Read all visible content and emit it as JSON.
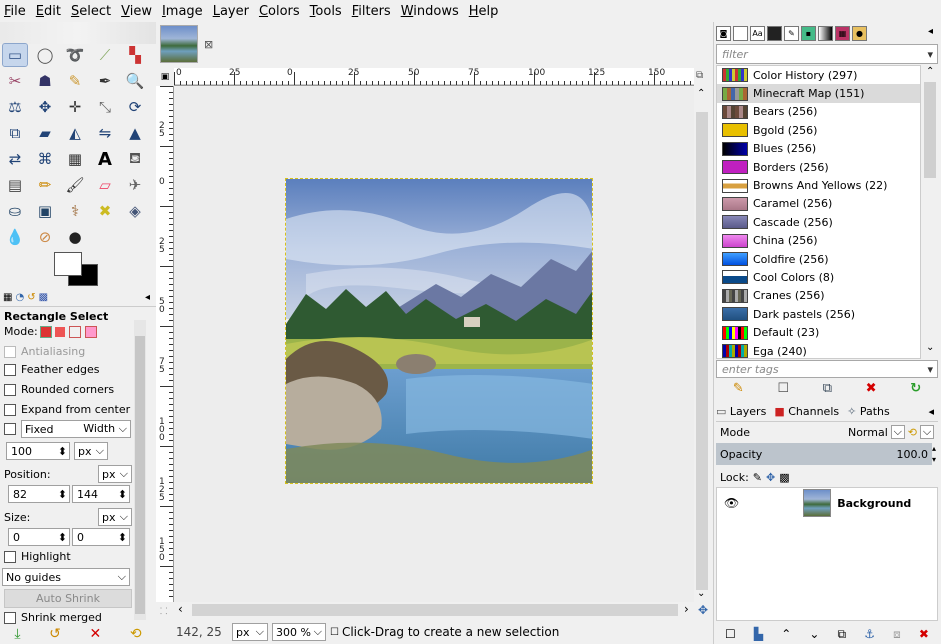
{
  "menubar": {
    "items": [
      {
        "label": "File"
      },
      {
        "label": "Edit"
      },
      {
        "label": "Select"
      },
      {
        "label": "View"
      },
      {
        "label": "Image"
      },
      {
        "label": "Layer"
      },
      {
        "label": "Colors"
      },
      {
        "label": "Tools"
      },
      {
        "label": "Filters"
      },
      {
        "label": "Windows"
      },
      {
        "label": "Help"
      }
    ]
  },
  "tool_options": {
    "title": "Rectangle Select",
    "mode_label": "Mode:",
    "antialiasing": "Antialiasing",
    "feather_edges": "Feather edges",
    "rounded_corners": "Rounded corners",
    "expand_from_center": "Expand from center",
    "fixed_label": "Fixed",
    "fixed_value": "Width",
    "fixed_number": "100",
    "fixed_unit": "px",
    "position_label": "Position:",
    "position_unit": "px",
    "position_x": "82",
    "position_y": "144",
    "size_label": "Size:",
    "size_unit": "px",
    "size_w": "0",
    "size_h": "0",
    "highlight": "Highlight",
    "guides": "No guides",
    "auto_shrink": "Auto Shrink",
    "shrink_merged": "Shrink merged"
  },
  "rulers": {
    "horizontal": [
      "0",
      "25",
      "0",
      "25",
      "50",
      "75",
      "100",
      "125",
      "150"
    ],
    "vertical": [
      "2\n5",
      "0",
      "2\n5",
      "5\n0",
      "7\n5",
      "1\n0\n0",
      "1\n2\n5",
      "1\n5\n0"
    ]
  },
  "statusbar": {
    "coords": "142, 25",
    "unit": "px",
    "zoom": "300 %",
    "message": "Click-Drag to create a new selection"
  },
  "palettes": {
    "filter_placeholder": "filter",
    "tags_placeholder": "enter tags",
    "items": [
      {
        "name": "Color History (297)"
      },
      {
        "name": "Minecraft Map (151)"
      },
      {
        "name": "Bears (256)"
      },
      {
        "name": "Bgold (256)"
      },
      {
        "name": "Blues (256)"
      },
      {
        "name": "Borders (256)"
      },
      {
        "name": "Browns And Yellows (22)"
      },
      {
        "name": "Caramel (256)"
      },
      {
        "name": "Cascade (256)"
      },
      {
        "name": "China (256)"
      },
      {
        "name": "Coldfire (256)"
      },
      {
        "name": "Cool Colors (8)"
      },
      {
        "name": "Cranes (256)"
      },
      {
        "name": "Dark pastels (256)"
      },
      {
        "name": "Default (23)"
      },
      {
        "name": "Ega (240)"
      }
    ]
  },
  "layers": {
    "tabs": [
      "Layers",
      "Channels",
      "Paths"
    ],
    "mode_label": "Mode",
    "mode_value": "Normal",
    "opacity_label": "Opacity",
    "opacity_value": "100.0",
    "lock_label": "Lock:",
    "layer_name": "Background"
  },
  "colors": {
    "selection_accent": "#c6d6ec",
    "opacity_bar": "#bcc4cc",
    "delete_red": "#d40000",
    "refresh_green": "#2a9d2a"
  }
}
